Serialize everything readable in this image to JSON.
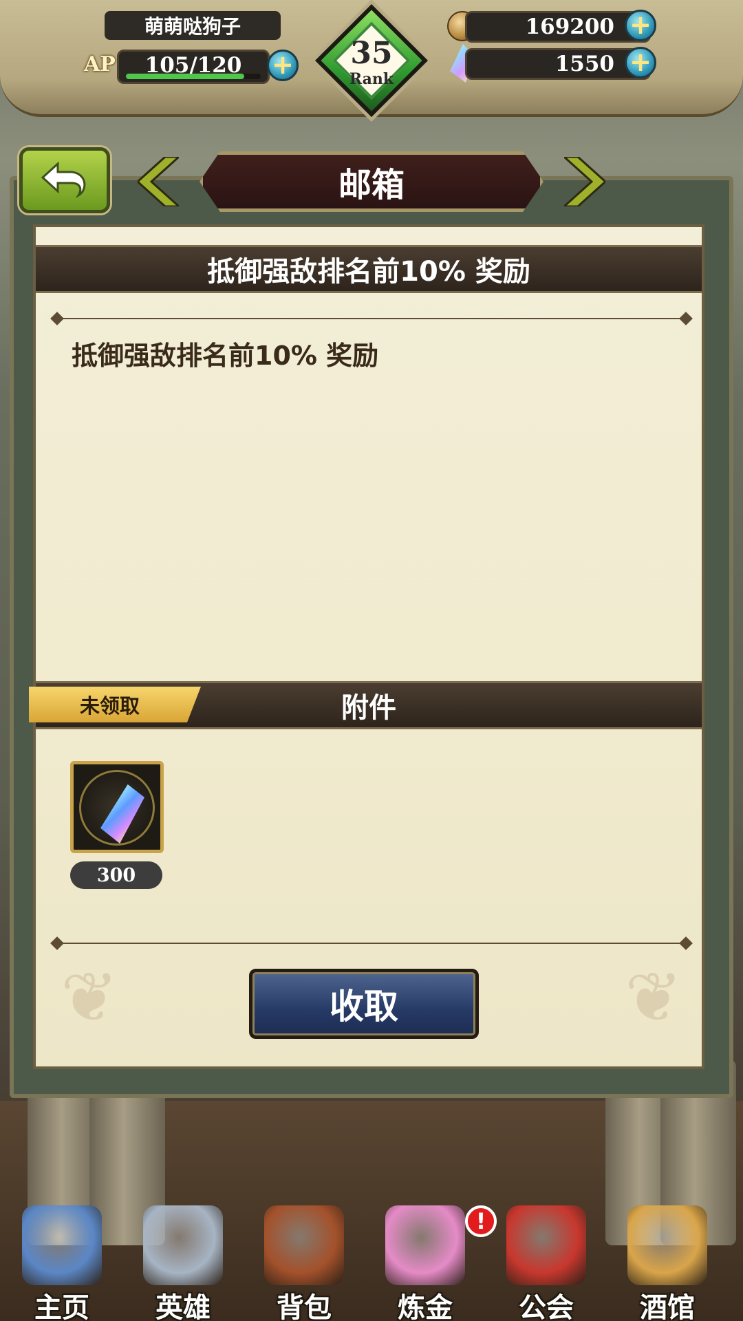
{
  "player": {
    "name": "萌萌哒狗子",
    "ap_label": "AP",
    "ap": "105/120",
    "ap_fraction": 0.875
  },
  "rank": {
    "value": "35",
    "label": "Rank"
  },
  "resources": {
    "gold": "169200",
    "crystals": "1550"
  },
  "header": {
    "title": "邮箱"
  },
  "mail": {
    "subject": "抵御强敌排名前10% 奖励",
    "body": "抵御强敌排名前10% 奖励",
    "attachments_title": "附件",
    "status_badge": "未领取",
    "attachments": [
      {
        "icon": "crystal-icon",
        "quantity": "300"
      }
    ],
    "collect_label": "收取"
  },
  "nav": {
    "items": [
      {
        "label": "主页",
        "icon": "castle-icon",
        "color": "#5b87c6"
      },
      {
        "label": "英雄",
        "icon": "helmet-icon",
        "color": "#a7b4c4"
      },
      {
        "label": "背包",
        "icon": "bag-icon",
        "color": "#a4512b"
      },
      {
        "label": "炼金",
        "icon": "potion-icon",
        "color": "#e58bc7"
      },
      {
        "label": "公会",
        "icon": "shield-icon",
        "color": "#c8372e"
      },
      {
        "label": "酒馆",
        "icon": "beer-icon",
        "color": "#d9a54a"
      }
    ],
    "alert": "!"
  }
}
